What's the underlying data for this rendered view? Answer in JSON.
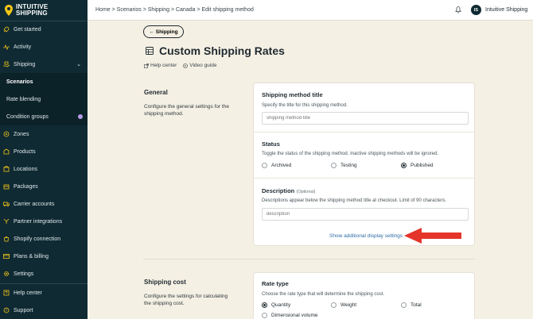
{
  "brand": {
    "line1": "INTUITIVE",
    "line2": "SHIPPING"
  },
  "sidebar": {
    "items": [
      {
        "label": "Get started",
        "icon": "rocket-icon"
      },
      {
        "label": "Activity",
        "icon": "activity-icon"
      },
      {
        "label": "Shipping",
        "icon": "shipping-hand-icon"
      }
    ],
    "subitems": [
      {
        "label": "Scenarios"
      },
      {
        "label": "Rate blending"
      },
      {
        "label": "Condition groups"
      }
    ],
    "items2": [
      {
        "label": "Zones",
        "icon": "zones-icon"
      },
      {
        "label": "Products",
        "icon": "products-icon"
      },
      {
        "label": "Locations",
        "icon": "locations-icon"
      },
      {
        "label": "Packages",
        "icon": "packages-icon"
      },
      {
        "label": "Carrier accounts",
        "icon": "truck-icon"
      },
      {
        "label": "Partner integrations",
        "icon": "integrations-icon"
      },
      {
        "label": "Shopify connection",
        "icon": "shopify-icon"
      },
      {
        "label": "Plans & billing",
        "icon": "billing-icon"
      },
      {
        "label": "Settings",
        "icon": "gear-icon"
      }
    ],
    "footer": [
      {
        "label": "Help center",
        "icon": "help-icon"
      },
      {
        "label": "Support",
        "icon": "support-icon"
      }
    ]
  },
  "topbar": {
    "breadcrumb": "Home > Scenarios > Shipping > Canada > Edit shipping method",
    "avatar_initials": "IS",
    "user_name": "Intuitive Shipping"
  },
  "main": {
    "back_label": "← Shipping",
    "title": "Custom Shipping Rates",
    "help_center": "Help center",
    "video_guide": "Video guide"
  },
  "general": {
    "heading": "General",
    "description": "Configure the general settings for the shipping method.",
    "method_title": {
      "label": "Shipping method title",
      "help": "Specify the title for this shipping method.",
      "placeholder": "shipping method title"
    },
    "status": {
      "label": "Status",
      "help": "Toggle the status of the shipping method. Inactive shipping methods will be ignored.",
      "options": [
        "Archived",
        "Testing",
        "Published"
      ],
      "selected": "Published"
    },
    "description_field": {
      "label": "Description",
      "optional": "(Optional)",
      "help": "Descriptions appear below the shipping method title at checkout. Limit of 90 characters.",
      "placeholder": "description"
    },
    "additional_link": "Show additional display settings"
  },
  "shipping_cost": {
    "heading": "Shipping cost",
    "description": "Configure the settings for calculating the shipping cost.",
    "rate_type": {
      "label": "Rate type",
      "help": "Choose the rate type that will determine the shipping cost.",
      "options": [
        "Quantity",
        "Weight",
        "Total",
        "Dimensional volume"
      ],
      "selected": "Quantity"
    }
  },
  "colors": {
    "sidebar_bg": "#0f2a33",
    "page_bg": "#f5f0e4",
    "accent_red": "#e5342a",
    "link_blue": "#2e6ca6",
    "logo_yellow": "#f5c518"
  }
}
